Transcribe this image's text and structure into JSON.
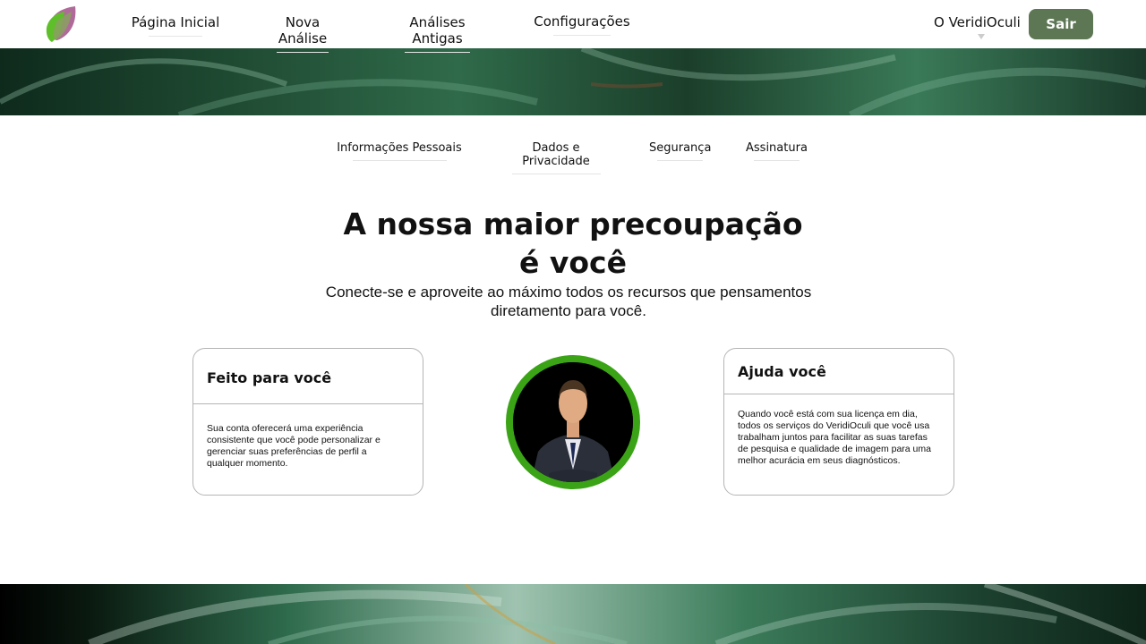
{
  "nav": {
    "home": "Página Inicial",
    "new_analysis": "Nova Análise",
    "old_analyses": "Análises Antigas",
    "settings": "Configurações",
    "about": "O VeridiOculi",
    "logout": "Sair"
  },
  "subnav": {
    "personal_info": "Informações Pessoais",
    "data_privacy": "Dados e Privacidade",
    "security": "Segurança",
    "subscription": "Assinatura"
  },
  "hero": {
    "headline_line1": "A nossa maior precoupação",
    "headline_line2": "é você",
    "subtitle_line1": "Conecte-se e aproveite ao máximo todos os recursos que pensamentos",
    "subtitle_line2": "diretamento para você."
  },
  "cards": {
    "left": {
      "title": "Feito para você",
      "body": "Sua conta oferecerá uma experiência consistente que você pode personalizar e gerenciar suas preferências de perfil a qualquer momento."
    },
    "right": {
      "title": "Ajuda você",
      "body": "Quando você está com sua licença em dia, todos os serviços do VeridiOculi que você usa trabalham juntos para facilitar as suas tarefas de pesquisa e qualidade de imagem para uma melhor acurácia em seus diagnósticos."
    }
  },
  "colors": {
    "logout_button": "#5d7654",
    "avatar_ring": "#3ba316",
    "card_border": "#b5b5b5"
  },
  "icons": {
    "logo": "leaf-logo-icon",
    "about_dropdown": "caret-down-icon"
  }
}
